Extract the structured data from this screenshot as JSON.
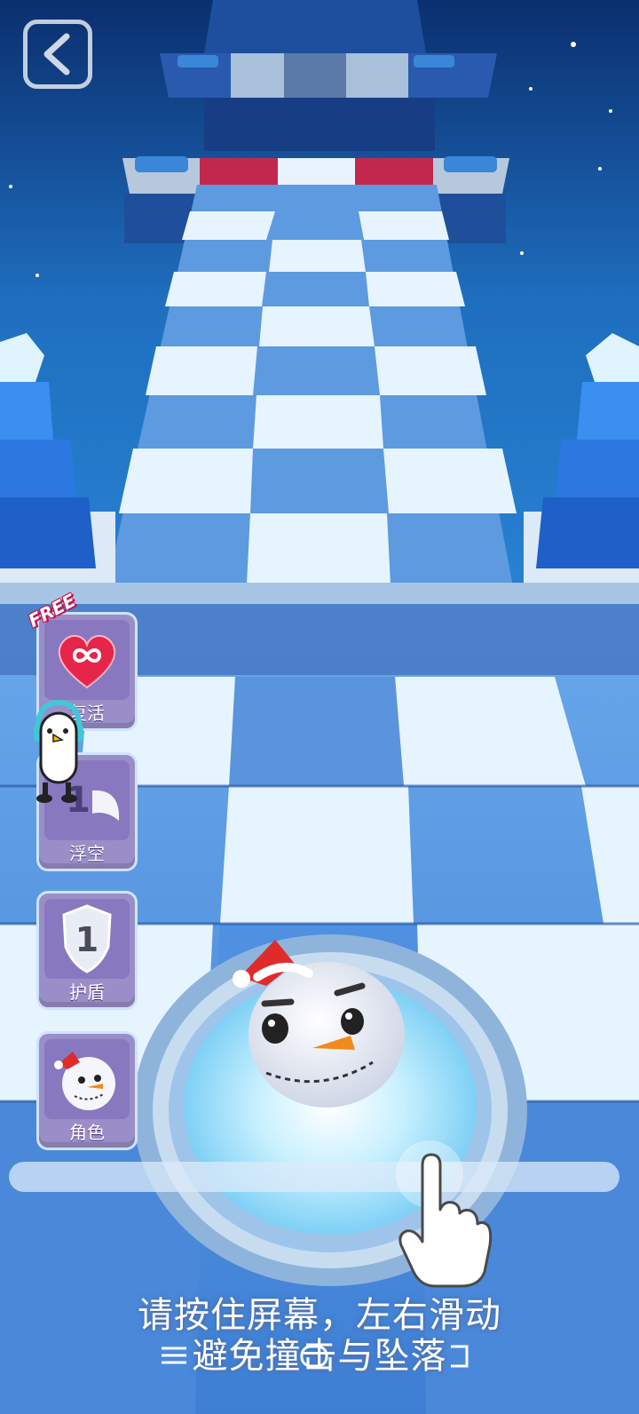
{
  "hud": {
    "back_icon": "chevron-left-icon"
  },
  "powerups": [
    {
      "id": "revive",
      "label": "复活",
      "icon": "infinity-heart-icon",
      "badge": "FREE"
    },
    {
      "id": "float",
      "label": "浮空",
      "icon": "wing-icon",
      "count": "1"
    },
    {
      "id": "shield",
      "label": "护盾",
      "icon": "shield-icon",
      "count": "1"
    },
    {
      "id": "character",
      "label": "角色",
      "icon": "snowman-icon"
    }
  ],
  "tutorial": {
    "line1": "请按住屏幕，左右滑动",
    "line2": "避免撞击与坠落"
  },
  "colors": {
    "sky": "#0f4fa0",
    "tile_light": "#e6f4ff",
    "tile_dark": "#5d9ae0",
    "danger_tile": "#c2284e",
    "powerup_bg": "#9a8ec8"
  }
}
